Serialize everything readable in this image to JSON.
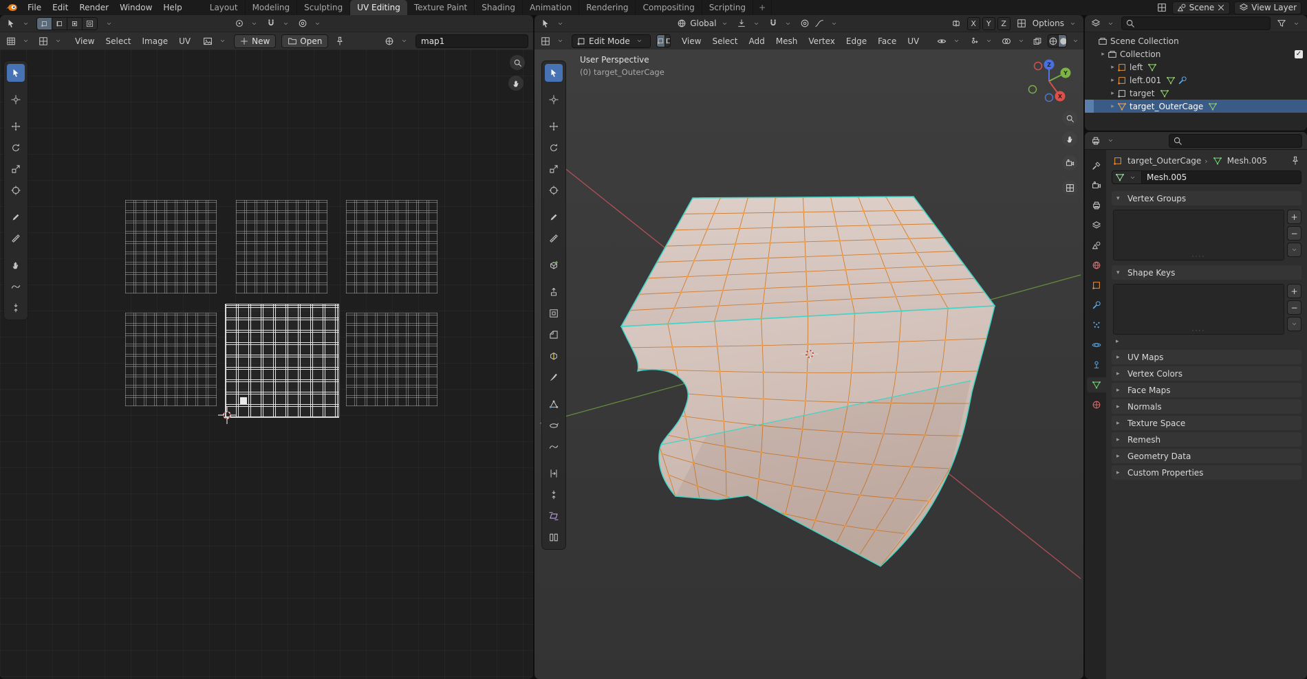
{
  "topbar": {
    "menus": [
      {
        "label": "File"
      },
      {
        "label": "Edit"
      },
      {
        "label": "Render"
      },
      {
        "label": "Window"
      },
      {
        "label": "Help"
      }
    ],
    "workspaces": [
      {
        "label": "Layout"
      },
      {
        "label": "Modeling"
      },
      {
        "label": "Sculpting"
      },
      {
        "label": "UV Editing",
        "active": true
      },
      {
        "label": "Texture Paint"
      },
      {
        "label": "Shading"
      },
      {
        "label": "Animation"
      },
      {
        "label": "Rendering"
      },
      {
        "label": "Compositing"
      },
      {
        "label": "Scripting"
      }
    ],
    "new_workspace_label": "+",
    "scene_label": "Scene",
    "view_layer_label": "View Layer"
  },
  "uv_editor": {
    "menus": [
      {
        "label": "View"
      },
      {
        "label": "Select"
      },
      {
        "label": "Image"
      },
      {
        "label": "UV"
      }
    ],
    "new_label": "New",
    "open_label": "Open",
    "image_name": "map1",
    "select_modes": [
      {
        "name": "vertex",
        "icon": "vertex-mode",
        "active": true
      },
      {
        "name": "edge",
        "icon": "edge-mode"
      },
      {
        "name": "face",
        "icon": "face-mode"
      },
      {
        "name": "island",
        "icon": "inset"
      }
    ],
    "toolbar": [
      {
        "name": "select-box",
        "icon": "cursor",
        "active": true
      },
      {
        "name": "cursor",
        "icon": "crosshair",
        "gap": true
      },
      {
        "name": "move",
        "icon": "move",
        "gap": true
      },
      {
        "name": "rotate",
        "icon": "rotate"
      },
      {
        "name": "scale",
        "icon": "scale"
      },
      {
        "name": "transform",
        "icon": "transform"
      },
      {
        "name": "annotate",
        "icon": "annotate",
        "gap": true
      },
      {
        "name": "measure",
        "icon": "measure"
      },
      {
        "name": "grab",
        "icon": "hand",
        "gap": true
      },
      {
        "name": "relax",
        "icon": "smooth"
      },
      {
        "name": "pinch",
        "icon": "shrink-fatten"
      }
    ]
  },
  "viewport": {
    "mode_label": "Edit Mode",
    "menus": [
      {
        "label": "View"
      },
      {
        "label": "Select"
      },
      {
        "label": "Add"
      },
      {
        "label": "Mesh"
      },
      {
        "label": "Vertex"
      },
      {
        "label": "Edge"
      },
      {
        "label": "Face"
      },
      {
        "label": "UV"
      }
    ],
    "select_modes": [
      {
        "name": "vertex",
        "icon": "vertex-mode",
        "active": true
      },
      {
        "name": "edge",
        "icon": "edge-mode"
      },
      {
        "name": "face",
        "icon": "face-mode"
      }
    ],
    "orientation_label": "Global",
    "mirror_axes": [
      "X",
      "Y",
      "Z"
    ],
    "options_label": "Options",
    "overlay_line1": "User Perspective",
    "overlay_line2": "(0) target_OuterCage",
    "gizmo": {
      "x": "X",
      "y": "Y",
      "z": "Z"
    },
    "toolbar": [
      {
        "name": "select-box",
        "icon": "cursor",
        "active": true
      },
      {
        "name": "cursor",
        "icon": "crosshair",
        "gap": true
      },
      {
        "name": "move",
        "icon": "move",
        "gap": true
      },
      {
        "name": "rotate",
        "icon": "rotate"
      },
      {
        "name": "scale",
        "icon": "scale"
      },
      {
        "name": "transform",
        "icon": "transform"
      },
      {
        "name": "annotate",
        "icon": "annotate",
        "gap": true
      },
      {
        "name": "measure",
        "icon": "measure"
      },
      {
        "name": "add-cube",
        "icon": "add-cube",
        "gap": true
      },
      {
        "name": "extrude-region",
        "icon": "extrude",
        "gap": true
      },
      {
        "name": "inset-faces",
        "icon": "inset"
      },
      {
        "name": "bevel",
        "icon": "bevel"
      },
      {
        "name": "loop-cut",
        "icon": "loop-cut"
      },
      {
        "name": "knife",
        "icon": "knife"
      },
      {
        "name": "poly-build",
        "icon": "poly-build",
        "gap": true
      },
      {
        "name": "spin",
        "icon": "spin"
      },
      {
        "name": "smooth",
        "icon": "smooth"
      },
      {
        "name": "edge-slide",
        "icon": "edge-slide",
        "gap": true
      },
      {
        "name": "shrink-fatten",
        "icon": "shrink-fatten"
      },
      {
        "name": "shear",
        "icon": "shear",
        "color": "#c0a4e6"
      },
      {
        "name": "rip-region",
        "icon": "rip"
      }
    ]
  },
  "outliner": {
    "rows": [
      {
        "label": "Scene Collection",
        "icon": "collection",
        "icon_color": "#c8c8c8",
        "indent": 0
      },
      {
        "label": "Collection",
        "icon": "collection",
        "icon_color": "#c8c8c8",
        "indent": 1,
        "expand": true,
        "checkbox": true
      },
      {
        "label": "left",
        "icon": "object",
        "icon_color": "#e8913d",
        "indent": 2,
        "expand": true,
        "badges": [
          "mesh-data"
        ]
      },
      {
        "label": "left.001",
        "icon": "object",
        "icon_color": "#e8913d",
        "indent": 2,
        "expand": true,
        "badges": [
          "mesh-data",
          "wrench"
        ]
      },
      {
        "label": "target",
        "icon": "object",
        "icon_color": "#c8c8c8",
        "indent": 2,
        "expand": true,
        "badges": [
          "mesh-data"
        ]
      },
      {
        "label": "target_OuterCage",
        "icon": "mesh-data",
        "icon_color": "#f0a14a",
        "indent": 2,
        "expand": true,
        "selected": true,
        "badges": [
          "mesh-data"
        ]
      }
    ]
  },
  "properties": {
    "breadcrumb": {
      "object": "target_OuterCage",
      "data": "Mesh.005"
    },
    "name_value": "Mesh.005",
    "tabs": [
      {
        "name": "tool",
        "icon": "tool"
      },
      {
        "name": "render",
        "icon": "camera"
      },
      {
        "name": "output",
        "icon": "printer"
      },
      {
        "name": "view-layer",
        "icon": "layers"
      },
      {
        "name": "scene",
        "icon": "scene"
      },
      {
        "name": "world",
        "icon": "world",
        "color": "#cc7070"
      },
      {
        "name": "object",
        "icon": "object",
        "color": "#e8913d"
      },
      {
        "name": "modifiers",
        "icon": "wrench",
        "color": "#5aa8e8"
      },
      {
        "name": "particles",
        "icon": "particles",
        "color": "#5aa8e8"
      },
      {
        "name": "physics",
        "icon": "physics",
        "color": "#5aa8e8"
      },
      {
        "name": "constraints",
        "icon": "constraint",
        "color": "#5aa8e8"
      },
      {
        "name": "data",
        "icon": "mesh-data",
        "color": "#72ce72",
        "active": true
      },
      {
        "name": "material",
        "icon": "sphere-checker",
        "color": "#d86a6a"
      }
    ],
    "panels": [
      {
        "id": "vertex_groups",
        "label": "Vertex Groups",
        "expanded": true,
        "list": true
      },
      {
        "id": "shape_keys",
        "label": "Shape Keys",
        "expanded": true,
        "list": true,
        "extra_arrow": true
      },
      {
        "id": "uv_maps",
        "label": "UV Maps"
      },
      {
        "id": "vertex_colors",
        "label": "Vertex Colors"
      },
      {
        "id": "face_maps",
        "label": "Face Maps"
      },
      {
        "id": "normals",
        "label": "Normals"
      },
      {
        "id": "texture_space",
        "label": "Texture Space"
      },
      {
        "id": "remesh",
        "label": "Remesh"
      },
      {
        "id": "geometry_data",
        "label": "Geometry Data"
      },
      {
        "id": "custom_properties",
        "label": "Custom Properties"
      }
    ]
  },
  "colors": {
    "accent": "#4772b3",
    "selection": "#3b5b87",
    "mesh_fill": "#d6c6c0",
    "wireframe": "#cf7c2e",
    "vertex": "#ff9d35",
    "boundary_edge": "#3fd4c7",
    "axis_x": "#cd5560",
    "axis_y": "#6a9a3e"
  }
}
